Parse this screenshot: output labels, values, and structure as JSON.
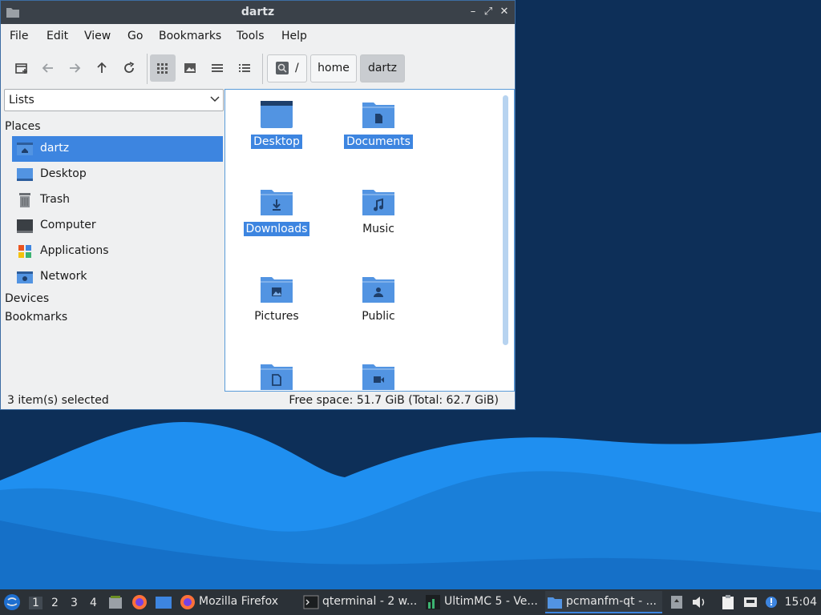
{
  "window": {
    "title": "dartz",
    "buttons": {
      "minimize": "–",
      "maximize": "⤢",
      "close": "✕"
    }
  },
  "menu": [
    "File",
    "Edit",
    "View",
    "Go",
    "Bookmarks",
    "Tools",
    "Help"
  ],
  "toolbar": {
    "icons": [
      "new-tab-icon",
      "back-arrow-icon",
      "forward-arrow-icon",
      "up-arrow-icon",
      "reload-icon",
      "icon-view-icon",
      "thumbnail-view-icon",
      "compact-view-icon",
      "detailed-list-view-icon"
    ],
    "breadcrumb": [
      "/",
      "home",
      "dartz"
    ]
  },
  "sidebar": {
    "select_value": "Lists",
    "places_label": "Places",
    "places": [
      {
        "label": "dartz",
        "icon": "home-folder-icon"
      },
      {
        "label": "Desktop",
        "icon": "desktop-icon"
      },
      {
        "label": "Trash",
        "icon": "trash-icon"
      },
      {
        "label": "Computer",
        "icon": "computer-icon"
      },
      {
        "label": "Applications",
        "icon": "applications-icon"
      },
      {
        "label": "Network",
        "icon": "network-icon"
      }
    ],
    "devices_label": "Devices",
    "bookmarks_label": "Bookmarks"
  },
  "files": [
    {
      "name": "Desktop",
      "icon": "desktop-folder-icon",
      "selected": true
    },
    {
      "name": "Documents",
      "icon": "documents-folder-icon",
      "selected": true
    },
    {
      "name": "Downloads",
      "icon": "downloads-folder-icon",
      "selected": true
    },
    {
      "name": "Music",
      "icon": "music-folder-icon",
      "selected": false
    },
    {
      "name": "Pictures",
      "icon": "pictures-folder-icon",
      "selected": false
    },
    {
      "name": "Public",
      "icon": "public-folder-icon",
      "selected": false
    },
    {
      "name": "",
      "icon": "templates-folder-icon",
      "selected": false
    },
    {
      "name": "",
      "icon": "videos-folder-icon",
      "selected": false
    }
  ],
  "status": {
    "selection": "3 item(s) selected",
    "free_space": "Free space: 51.7 GiB (Total: 62.7 GiB)"
  },
  "taskbar": {
    "desktops": [
      "1",
      "2",
      "3",
      "4"
    ],
    "tasks": [
      {
        "label": "Mozilla Firefox",
        "icon": "firefox-icon"
      },
      {
        "label": "qterminal - 2 w...",
        "icon": "terminal-icon"
      },
      {
        "label": "UltimMC 5 - Ve...",
        "icon": "ultimmc-icon"
      },
      {
        "label": "pcmanfm-qt - ...",
        "icon": "folder-icon"
      }
    ],
    "clock": "15:04"
  },
  "colors": {
    "selection": "#3d85e0",
    "folder": "#5294e2",
    "desktop_bg": "#0d2f58",
    "wave": "#1e90e8"
  }
}
